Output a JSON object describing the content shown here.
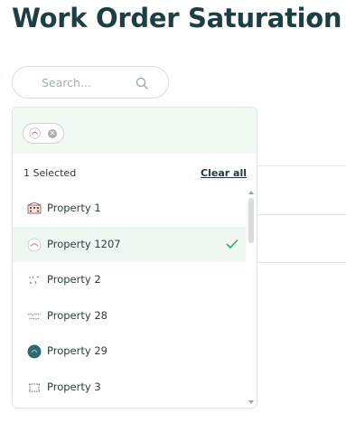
{
  "header": {
    "title": "Work Order Saturation"
  },
  "search": {
    "placeholder": "Search...",
    "value": ""
  },
  "dropdown": {
    "selected_count_text": "1 Selected",
    "clear_all_label": "Clear all",
    "items": [
      {
        "label": "Property 1",
        "thumb": "building-thumbnail",
        "selected": false
      },
      {
        "label": "Property 1207",
        "thumb": "logo-thumbnail",
        "selected": true
      },
      {
        "label": "Property 2",
        "thumb": "sketch-thumbnail",
        "selected": false
      },
      {
        "label": "Property 28",
        "thumb": "sketch-thumbnail",
        "selected": false
      },
      {
        "label": "Property 29",
        "thumb": "round-logo-thumbnail",
        "selected": false
      },
      {
        "label": "Property 3",
        "thumb": "sketch-thumbnail",
        "selected": false
      }
    ]
  },
  "colors": {
    "title": "#1d3f44",
    "selected_row_bg": "#eef8f1",
    "check": "#3aa55a",
    "chip_area_bg": "#f0faf3"
  }
}
